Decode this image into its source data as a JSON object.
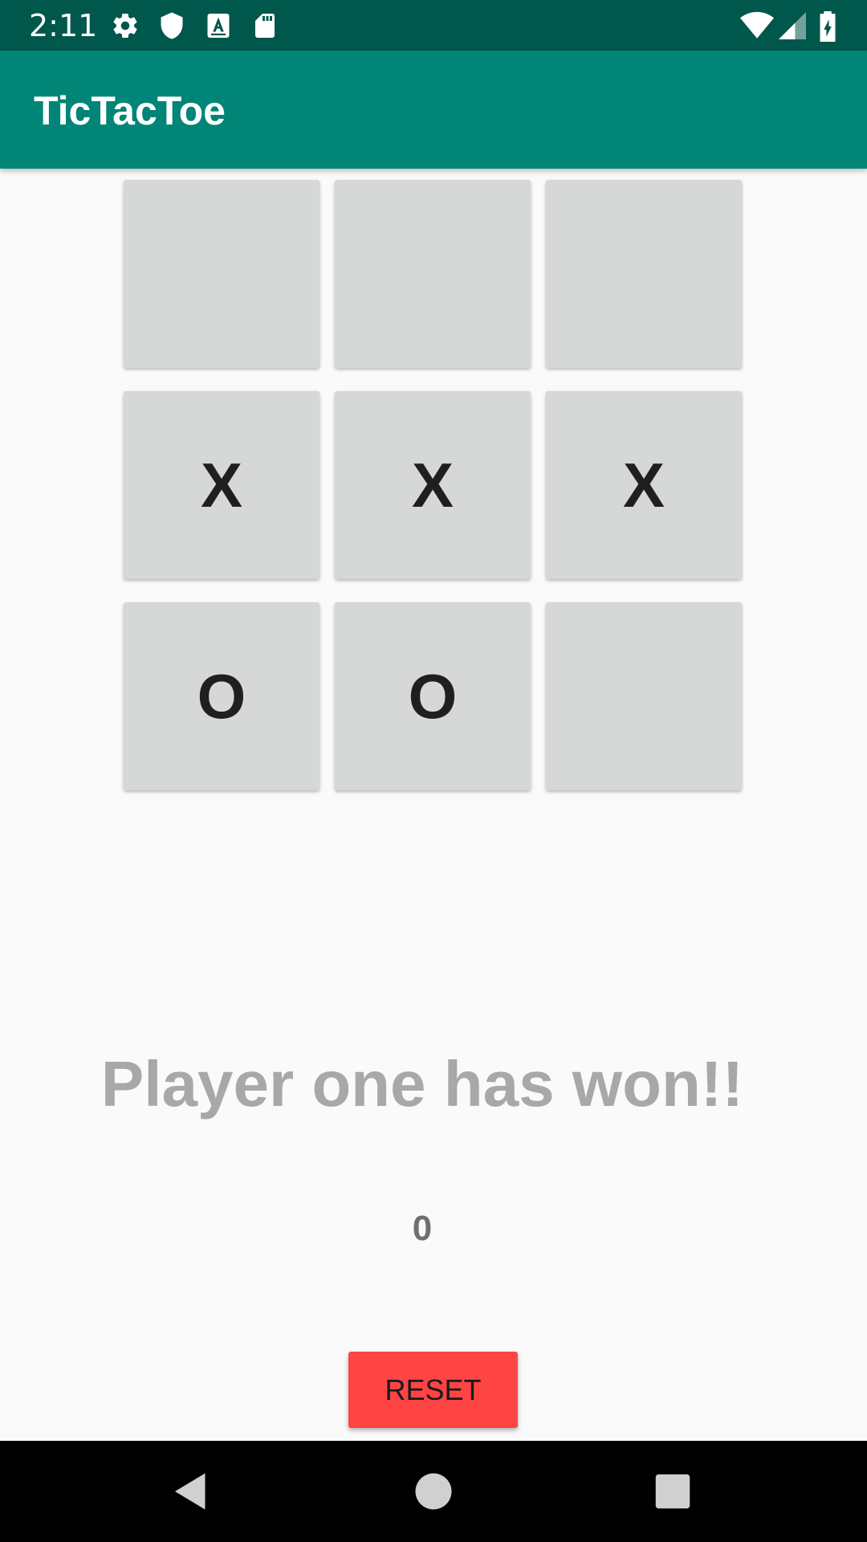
{
  "status_bar": {
    "time": "2:11",
    "left_icons": [
      "gear-icon",
      "shield-icon",
      "text-a-icon",
      "sd-card-icon"
    ],
    "right_icons": [
      "wifi-icon",
      "signal-icon",
      "battery-charging-icon"
    ]
  },
  "app_bar": {
    "title": "TicTacToe"
  },
  "board": {
    "cells": [
      "",
      "",
      "",
      "X",
      "X",
      "X",
      "O",
      "O",
      ""
    ]
  },
  "game": {
    "status_message": "Player one has won!!",
    "score": "0"
  },
  "actions": {
    "reset_label": "RESET"
  },
  "nav_bar": {
    "buttons": [
      "back-icon",
      "home-icon",
      "recents-icon"
    ]
  },
  "colors": {
    "status_bar": "#00574b",
    "app_bar": "#008577",
    "cell": "#d6d7d7",
    "reset_button": "#ff4444"
  }
}
